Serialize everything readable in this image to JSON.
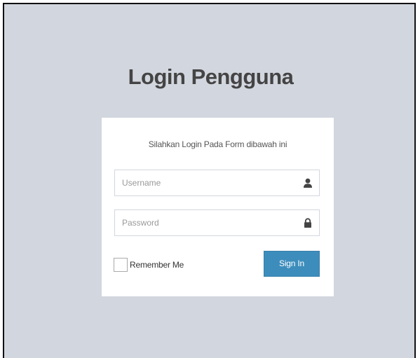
{
  "page": {
    "title": "Login Pengguna",
    "background_color": "#d2d6de"
  },
  "login_box": {
    "message": "Silahkan Login Pada Form dibawah ini",
    "username": {
      "placeholder": "Username",
      "value": "",
      "icon": "user-icon"
    },
    "password": {
      "placeholder": "Password",
      "value": "",
      "icon": "lock-icon"
    },
    "remember_label": "Remember Me",
    "remember_checked": false,
    "signin_label": "Sign In",
    "signin_color": "#3c8dbc"
  }
}
